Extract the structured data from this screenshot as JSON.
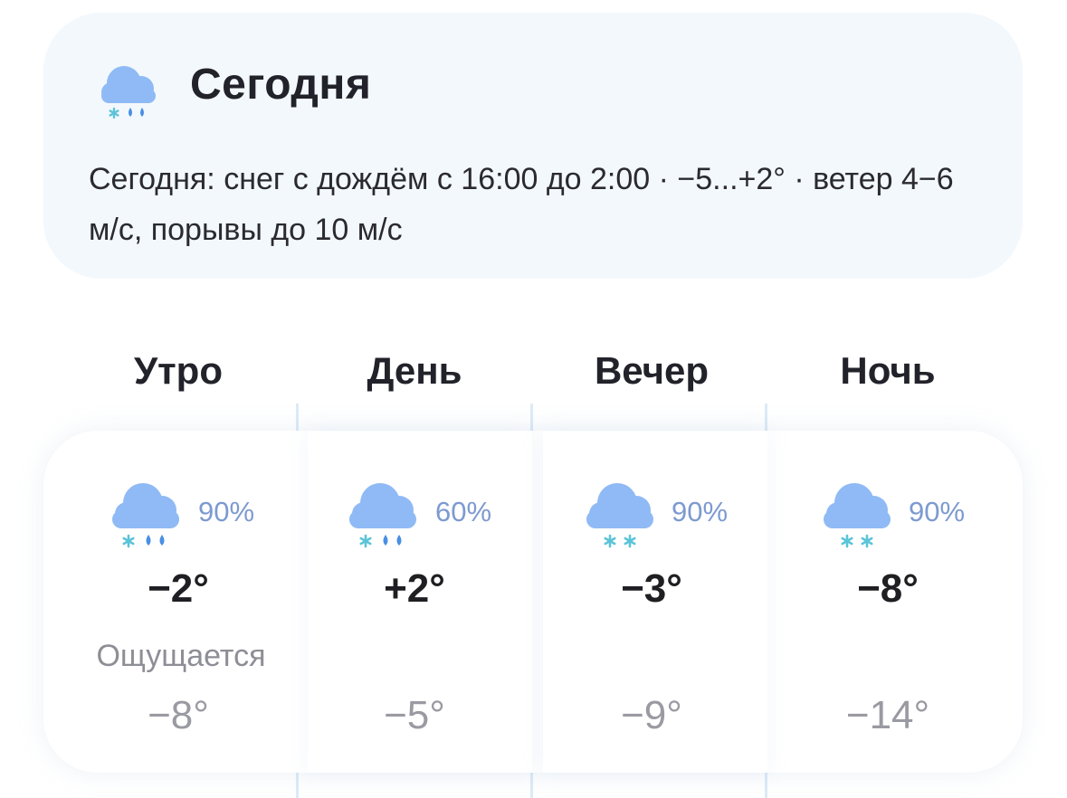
{
  "today": {
    "icon": "snow-rain-icon",
    "title": "Сегодня",
    "summary": "Сегодня: снег с дождём с 16:00 до 2:00 · −5...+2° · ветер 4−6 м/с, порывы до 10 м/с"
  },
  "feels_like_label": "Ощущается",
  "periods": [
    {
      "label": "Утро",
      "icon": "snow-rain-icon",
      "precip_probability": "90%",
      "temp": "−2°",
      "feels_like": "−8°"
    },
    {
      "label": "День",
      "icon": "snow-rain-icon",
      "precip_probability": "60%",
      "temp": "+2°",
      "feels_like": "−5°"
    },
    {
      "label": "Вечер",
      "icon": "snow-icon",
      "precip_probability": "90%",
      "temp": "−3°",
      "feels_like": "−9°"
    },
    {
      "label": "Ночь",
      "icon": "snow-icon",
      "precip_probability": "90%",
      "temp": "−8°",
      "feels_like": "−14°"
    }
  ],
  "colors": {
    "cloud": "#8fbaf5",
    "snowflake": "#5bc4d8",
    "raindrop": "#4a8fe3",
    "probability": "#7d9ad0",
    "card_background": "#f3f8fd"
  }
}
